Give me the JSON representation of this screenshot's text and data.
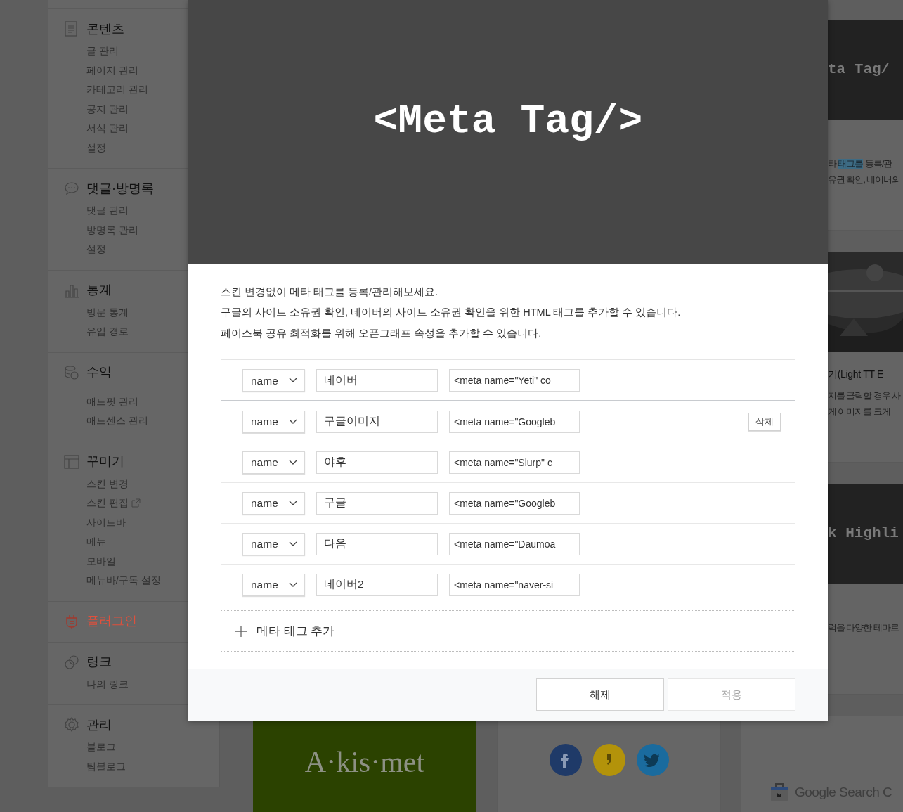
{
  "sidebar": {
    "sections": [
      {
        "title": "콘텐츠",
        "selected": false,
        "items": [
          {
            "label": "글 관리",
            "external": false
          },
          {
            "label": "페이지 관리",
            "external": false
          },
          {
            "label": "카테고리 관리",
            "external": false
          },
          {
            "label": "공지 관리",
            "external": false
          },
          {
            "label": "서식 관리",
            "external": false
          },
          {
            "label": "설정",
            "external": false
          }
        ]
      },
      {
        "title": "댓글·방명록",
        "selected": false,
        "items": [
          {
            "label": "댓글 관리",
            "external": false
          },
          {
            "label": "방명록 관리",
            "external": false
          },
          {
            "label": "설정",
            "external": false
          }
        ]
      },
      {
        "title": "통계",
        "selected": false,
        "items": [
          {
            "label": "방문 통계",
            "external": false
          },
          {
            "label": "유입 경로",
            "external": false
          }
        ]
      },
      {
        "title": "수익",
        "selected": false,
        "items": [
          {
            "label": "애드핏 관리",
            "external": false
          },
          {
            "label": "애드센스 관리",
            "external": false
          }
        ]
      },
      {
        "title": "꾸미기",
        "selected": false,
        "items": [
          {
            "label": "스킨 변경",
            "external": false
          },
          {
            "label": "스킨 편집",
            "external": true
          },
          {
            "label": "사이드바",
            "external": false
          },
          {
            "label": "메뉴",
            "external": false
          },
          {
            "label": "모바일",
            "external": false
          },
          {
            "label": "메뉴바/구독 설정",
            "external": false
          }
        ]
      },
      {
        "title": "플러그인",
        "selected": true
      },
      {
        "title": "링크",
        "selected": false,
        "items": [
          {
            "label": "나의 링크",
            "external": false
          }
        ]
      },
      {
        "title": "관리",
        "selected": false,
        "items": [
          {
            "label": "블로그",
            "external": false
          },
          {
            "label": "팀블로그",
            "external": false
          }
        ]
      }
    ]
  },
  "side_cards": [
    {
      "kind": "code",
      "art_text": "ta Tag/",
      "lines": [
        [
          {
            "text": "타 ",
            "highlighted": false
          },
          {
            "text": "태그를",
            "highlighted": true
          },
          {
            "text": " 등록/관",
            "highlighted": false
          }
        ],
        [
          {
            "text": "유권 확인, 네이버의",
            "highlighted": false
          }
        ]
      ]
    },
    {
      "kind": "picture",
      "title": "기(Light TT E",
      "lines": [
        [
          {
            "text": "지를 클릭할 경우 사",
            "highlighted": false
          }
        ],
        [
          {
            "text": "게 이미지를 크게",
            "highlighted": false
          }
        ]
      ]
    },
    {
      "kind": "code",
      "art_text": "k Highli",
      "lines": [
        [
          {
            "text": "럭을 다양한 테마로",
            "highlighted": false
          }
        ]
      ]
    }
  ],
  "bottom_cards": [
    {
      "kind": "akismet",
      "logo_text": "A·kis·met"
    },
    {
      "kind": "social",
      "icons": [
        {
          "color": "#1f3a68"
        },
        {
          "color": "#b3930a"
        },
        {
          "color": "#1a6b9e"
        }
      ]
    },
    {
      "kind": "google",
      "logo_text": "Google Search C"
    }
  ],
  "modal": {
    "banner_title": "<Meta Tag/>",
    "intro": [
      "스킨 변경없이 메타 태그를 등록/관리해보세요.",
      "구글의 사이트 소유권 확인, 네이버의 사이트 소유권 확인을 위한 HTML 태그를 추가할 수 있습니다.",
      "페이스북 공유 최적화를 위해 오픈그래프 속성을 추가할 수 있습니다."
    ],
    "delete_label": "삭제",
    "meta_rows": [
      {
        "attr": "name",
        "label": "네이버",
        "content": "<meta name=\"Yeti\" co",
        "hovered": false
      },
      {
        "attr": "name",
        "label": "구글이미지",
        "content": "<meta name=\"Googleb",
        "hovered": true
      },
      {
        "attr": "name",
        "label": "야후",
        "content": "<meta name=\"Slurp\" c",
        "hovered": false
      },
      {
        "attr": "name",
        "label": "구글",
        "content": "<meta name=\"Googleb",
        "hovered": false
      },
      {
        "attr": "name",
        "label": "다음",
        "content": "<meta name=\"Daumoa",
        "hovered": false
      },
      {
        "attr": "name",
        "label": "네이버2",
        "content": "<meta name=\"naver-si",
        "hovered": false
      }
    ],
    "add_label": "메타 태그 추가",
    "buttons": [
      {
        "label": "해제",
        "disabled": false
      },
      {
        "label": "적용",
        "disabled": true
      }
    ]
  }
}
